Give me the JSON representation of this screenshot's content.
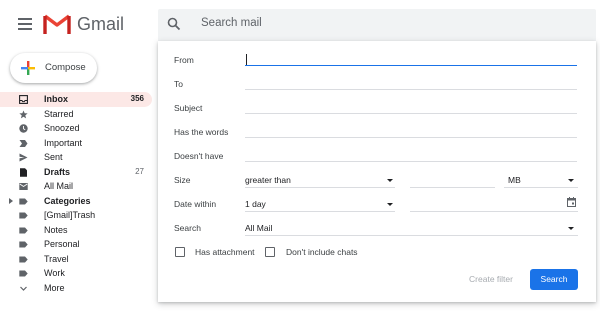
{
  "header": {
    "brand": "Gmail",
    "search_placeholder": "Search mail"
  },
  "compose": {
    "label": "Compose"
  },
  "sidebar": {
    "items": [
      {
        "label": "Inbox",
        "count": "356",
        "icon": "inbox-icon",
        "bold": true,
        "active": true
      },
      {
        "label": "Starred",
        "icon": "star-icon"
      },
      {
        "label": "Snoozed",
        "icon": "clock-icon"
      },
      {
        "label": "Important",
        "icon": "important-icon"
      },
      {
        "label": "Sent",
        "icon": "send-icon"
      },
      {
        "label": "Drafts",
        "count": "27",
        "icon": "draft-icon",
        "bold": true
      },
      {
        "label": "All Mail",
        "icon": "all-mail-icon"
      },
      {
        "label": "Categories",
        "icon": "label-icon",
        "bold": true,
        "expandable": true
      },
      {
        "label": "[Gmail]Trash",
        "icon": "label-icon"
      },
      {
        "label": "Notes",
        "icon": "label-icon"
      },
      {
        "label": "Personal",
        "icon": "label-icon"
      },
      {
        "label": "Travel",
        "icon": "label-icon"
      },
      {
        "label": "Work",
        "icon": "label-icon"
      },
      {
        "label": "More",
        "icon": "chevron-down-icon"
      }
    ]
  },
  "search_options": {
    "from_label": "From",
    "to_label": "To",
    "subject_label": "Subject",
    "has_words_label": "Has the words",
    "doesnt_have_label": "Doesn't have",
    "size_label": "Size",
    "size_operator": "greater than",
    "size_unit": "MB",
    "date_within_label": "Date within",
    "date_within_value": "1 day",
    "search_label": "Search",
    "search_scope": "All Mail",
    "has_attachment_label": "Has attachment",
    "dont_include_chats_label": "Don't include chats",
    "create_filter_label": "Create filter",
    "search_button_label": "Search"
  },
  "colors": {
    "accent": "#1a73e8",
    "gmail_red": "#ea4335",
    "active_nav_bg": "#fce8e6"
  }
}
